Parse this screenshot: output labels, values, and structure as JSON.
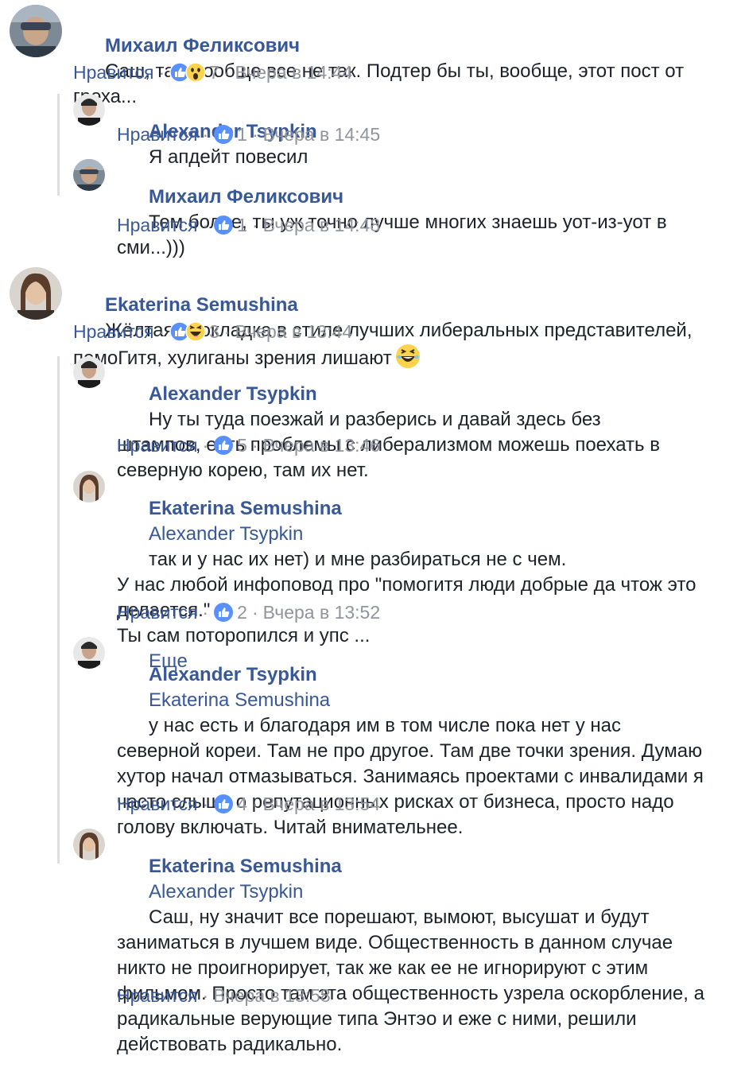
{
  "ui": {
    "like_label": "Нравится",
    "separator": "·",
    "see_more": "Еще"
  },
  "comments": [
    {
      "author": "Михаил Феликсович",
      "text": "Саш, там вообще все не так. Подтер бы ты, вообще, этот пост от греха...",
      "reactions": [
        "like",
        "wow"
      ],
      "count": "7",
      "time": "Вчера в 14:44",
      "replies": [
        {
          "author": "Alexander Tsypkin",
          "text": "Я апдейт повесил",
          "reactions": [
            "like"
          ],
          "count": "1",
          "time": "Вчера в 14:45"
        },
        {
          "author": "Михаил Феликсович",
          "text": "Тем более, ты уж точно лучше многих знаешь уот-из-уот в сми...)))",
          "reactions": [
            "like"
          ],
          "count": "1",
          "time": "Вчера в 14:48"
        }
      ]
    },
    {
      "author": "Ekaterina Semushina",
      "text": "Жёлтая прокладка в стиле лучших либеральных представителей, помоГитя, хулиганы зрения лишают",
      "text_emoji": "laughing-face",
      "reactions": [
        "like",
        "haha"
      ],
      "count": "3",
      "time": "Вчера в 13:44",
      "replies": [
        {
          "author": "Alexander Tsypkin",
          "text": "Ну ты туда поезжай и разберись и давай здесь без штампов, есть проблемы с либерализмом можешь поехать в северную корею, там их нет.",
          "reactions": [
            "like"
          ],
          "count": "5",
          "time": "Вчера в 13:46"
        },
        {
          "author": "Ekaterina Semushina",
          "mention": "Alexander Tsypkin",
          "text": "так и у нас их нет) и мне разбираться не с чем.\nУ нас любой инфоповод про \"помогитя люди добрые да чтож это делается.\"\nТы сам поторопился и упс ...",
          "see_more": true,
          "reactions": [
            "like"
          ],
          "count": "2",
          "time": "Вчера в 13:52"
        },
        {
          "author": "Alexander Tsypkin",
          "mention": "Ekaterina Semushina",
          "text": "у нас есть и благодаря им в том числе пока нет у нас северной кореи. Там не про другое. Там две точки зрения. Думаю хутор начал отмазываться. Занимаясь проектами с инвалидами я часто слышу о репутационных рисках от бизнеса, просто надо голову включать. Читай внимательнее.",
          "reactions": [
            "like"
          ],
          "count": "4",
          "time": "Вчера в 13:54"
        },
        {
          "author": "Ekaterina Semushina",
          "mention": "Alexander Tsypkin",
          "text": "Саш, ну значит все порешают, вымоют, высушат и будут заниматься в лучшем виде. Общественность в данном случае никто не проигнорирует, так же как ее не игнорируют с этим фильмом. Просто там эта общественность узрела оскорбление, а радикальные верующие типа Энтэо и еже с ними, решили действовать радикально.",
          "reactions": [],
          "count": "",
          "time": "Вчера в 13:58"
        }
      ]
    }
  ]
}
